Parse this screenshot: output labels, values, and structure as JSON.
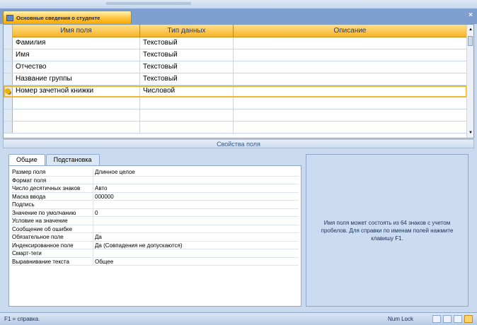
{
  "tab": {
    "title": "Основные сведения о студенте",
    "close": "×"
  },
  "grid": {
    "headers": [
      "Имя поля",
      "Тип данных",
      "Описание"
    ],
    "rows": [
      {
        "name": "Фамилия",
        "type": "Текстовый",
        "desc": ""
      },
      {
        "name": "Имя",
        "type": "Текстовый",
        "desc": ""
      },
      {
        "name": "Отчество",
        "type": "Текстовый",
        "desc": ""
      },
      {
        "name": "Название группы",
        "type": "Текстовый",
        "desc": ""
      },
      {
        "name": "Номер зачетной книжки",
        "type": "Числовой",
        "desc": ""
      },
      {
        "name": "",
        "type": "",
        "desc": ""
      },
      {
        "name": "",
        "type": "",
        "desc": ""
      },
      {
        "name": "",
        "type": "",
        "desc": ""
      }
    ],
    "scroll": {
      "up": "▲",
      "down": "▼"
    }
  },
  "properties": {
    "bar_title": "Свойства поля",
    "tabs": [
      "Общие",
      "Подстановка"
    ],
    "rows": [
      {
        "label": "Размер поля",
        "value": "Длинное целое"
      },
      {
        "label": "Формат поля",
        "value": ""
      },
      {
        "label": "Число десятичных знаков",
        "value": "Авто"
      },
      {
        "label": "Маска ввода",
        "value": "000000"
      },
      {
        "label": "Подпись",
        "value": ""
      },
      {
        "label": "Значение по умолчанию",
        "value": "0"
      },
      {
        "label": "Условие на значение",
        "value": ""
      },
      {
        "label": "Сообщение об ошибке",
        "value": ""
      },
      {
        "label": "Обязательное поле",
        "value": "Да"
      },
      {
        "label": "Индексированное поле",
        "value": "Да (Совпадения не допускаются)"
      },
      {
        "label": "Смарт-теги",
        "value": ""
      },
      {
        "label": "Выравнивание текста",
        "value": "Общее"
      }
    ],
    "help": "Имя поля может состоять из 64 знаков с учетом пробелов. Для справки по именам полей нажмите клавишу F1."
  },
  "status": {
    "left": "F1 = справка.",
    "numlock": "Num Lock"
  }
}
